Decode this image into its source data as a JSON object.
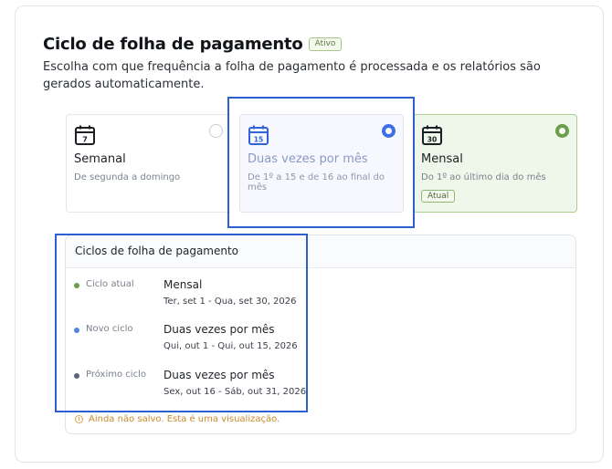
{
  "header": {
    "title": "Ciclo de folha de pagamento",
    "status_badge": "Ativo",
    "description": "Escolha com que frequência a folha de pagamento é processada e os relatórios são gerados automaticamente."
  },
  "options": [
    {
      "icon": "calendar-7-icon",
      "day": "7",
      "label": "Semanal",
      "sub": "De segunda a domingo",
      "selected": false
    },
    {
      "icon": "calendar-15-icon",
      "day": "15",
      "label": "Duas vezes por mês",
      "sub": "De 1º a 15 e de 16 ao final do mês",
      "selected": true
    },
    {
      "icon": "calendar-30-icon",
      "day": "30",
      "label": "Mensal",
      "sub": "Do 1º ao último dia do mês",
      "selected": true,
      "badge": "Atual"
    }
  ],
  "cycles": {
    "title": "Ciclos de folha de pagamento",
    "rows": [
      {
        "tag": "Ciclo atual",
        "name": "Mensal",
        "dates": "Ter, set 1 - Qua, set 30, 2026",
        "dot_color": "#6a9e4a"
      },
      {
        "tag": "Novo ciclo",
        "name": "Duas vezes por mês",
        "dates": "Qui, out 1 - Qui, out 15, 2026",
        "dot_color": "#4f86d9"
      },
      {
        "tag": "Próximo ciclo",
        "name": "Duas vezes por mês",
        "dates": "Sex, out 16 - Sáb, out 31, 2026",
        "dot_color": "#5b6478"
      }
    ],
    "notice_strong": "Ainda não salvo.",
    "notice_rest": " Esta é uma visualização."
  },
  "colors": {
    "accent_blue": "#3d6fe6",
    "accent_green": "#6a9e4a",
    "warning": "#c98a2a"
  }
}
